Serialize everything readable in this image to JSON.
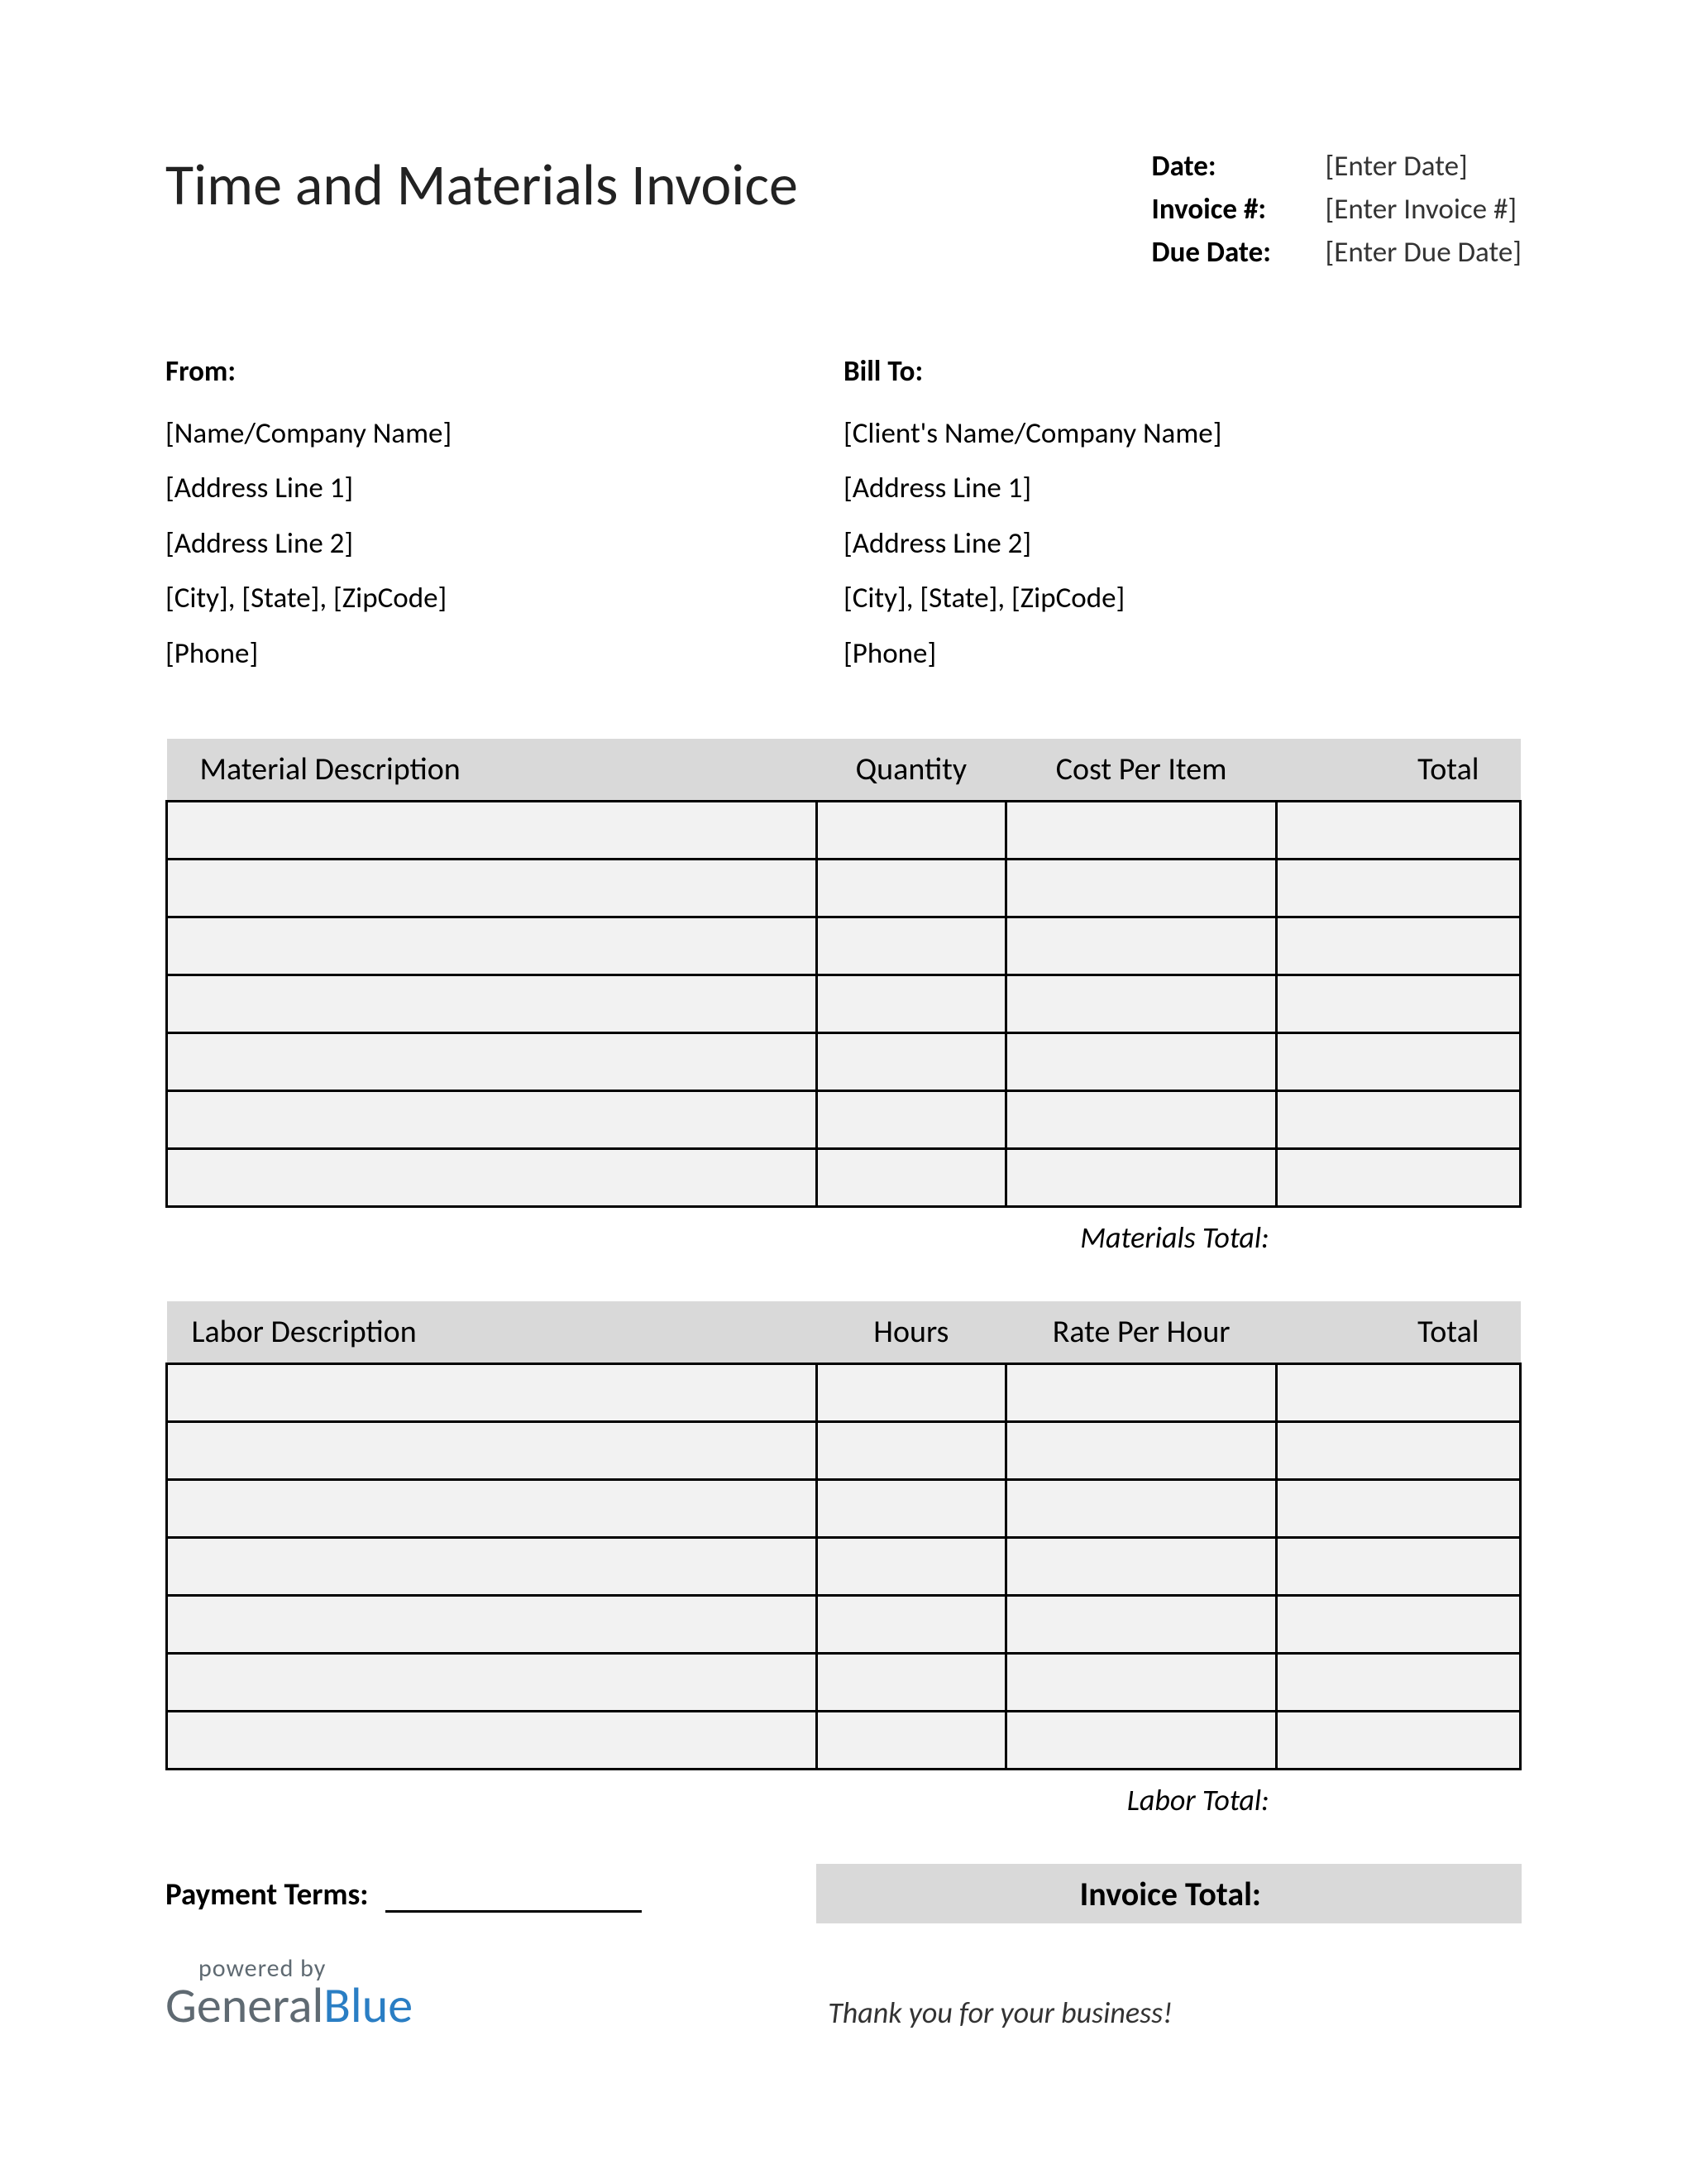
{
  "title": "Time and Materials Invoice",
  "meta": {
    "date_label": "Date:",
    "date_value": "[Enter Date]",
    "invoice_label": "Invoice #:",
    "invoice_value": "[Enter Invoice #]",
    "due_label": "Due Date:",
    "due_value": "[Enter Due Date]"
  },
  "from": {
    "heading": "From:",
    "name": "[Name/Company Name]",
    "addr1": "[Address Line 1]",
    "addr2": "[Address Line 2]",
    "city": "[City], [State], [ZipCode]",
    "phone": "[Phone]"
  },
  "billto": {
    "heading": "Bill To:",
    "name": "[Client's Name/Company Name]",
    "addr1": "[Address Line 1]",
    "addr2": "[Address Line 2]",
    "city": "[City], [State], [ZipCode]",
    "phone": "[Phone]"
  },
  "materials": {
    "headers": {
      "desc": "Material Description",
      "qty": "Quantity",
      "cost": "Cost Per Item",
      "total": "Total"
    },
    "rows": [
      {
        "desc": "",
        "qty": "",
        "cost": "",
        "total": ""
      },
      {
        "desc": "",
        "qty": "",
        "cost": "",
        "total": ""
      },
      {
        "desc": "",
        "qty": "",
        "cost": "",
        "total": ""
      },
      {
        "desc": "",
        "qty": "",
        "cost": "",
        "total": ""
      },
      {
        "desc": "",
        "qty": "",
        "cost": "",
        "total": ""
      },
      {
        "desc": "",
        "qty": "",
        "cost": "",
        "total": ""
      },
      {
        "desc": "",
        "qty": "",
        "cost": "",
        "total": ""
      }
    ],
    "subtotal_label": "Materials Total:",
    "subtotal_value": ""
  },
  "labor": {
    "headers": {
      "desc": "Labor Description",
      "hours": "Hours",
      "rate": "Rate Per Hour",
      "total": "Total"
    },
    "rows": [
      {
        "desc": "",
        "hours": "",
        "rate": "",
        "total": ""
      },
      {
        "desc": "",
        "hours": "",
        "rate": "",
        "total": ""
      },
      {
        "desc": "",
        "hours": "",
        "rate": "",
        "total": ""
      },
      {
        "desc": "",
        "hours": "",
        "rate": "",
        "total": ""
      },
      {
        "desc": "",
        "hours": "",
        "rate": "",
        "total": ""
      },
      {
        "desc": "",
        "hours": "",
        "rate": "",
        "total": ""
      },
      {
        "desc": "",
        "hours": "",
        "rate": "",
        "total": ""
      }
    ],
    "subtotal_label": "Labor Total:",
    "subtotal_value": ""
  },
  "payment_terms_label": "Payment Terms:",
  "payment_terms_value": "",
  "invoice_total_label": "Invoice Total:",
  "invoice_total_value": "",
  "branding": {
    "powered": "powered by",
    "logo1": "General",
    "logo2": "Blue"
  },
  "thankyou": "Thank you for your business!"
}
